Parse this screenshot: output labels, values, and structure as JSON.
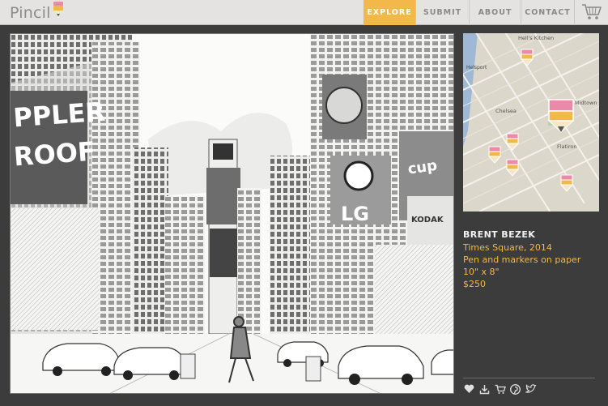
{
  "brand": {
    "name": "Pincil"
  },
  "nav": {
    "items": [
      {
        "label": "EXPLORE",
        "active": true
      },
      {
        "label": "SUBMIT",
        "active": false
      },
      {
        "label": "ABOUT",
        "active": false
      },
      {
        "label": "CONTACT",
        "active": false
      }
    ],
    "cart_icon": "cart-icon"
  },
  "artwork": {
    "subject": "Times Square street sketch",
    "signs": [
      "LG",
      "KODAK",
      "CUPCAKE",
      "PLER ROOF"
    ]
  },
  "map": {
    "labels": [
      "Hell's Kitchen",
      "Midtown",
      "Chelsea",
      "Flatiron",
      "Helsport"
    ],
    "pin_icon": "pencil-pin-icon"
  },
  "details": {
    "artist": "BRENT BEZEK",
    "title_year": "Times Square, 2014",
    "medium": "Pen and markers on paper",
    "size": "10\" x 8\"",
    "price": "$250"
  },
  "actions": [
    "heart-icon",
    "download-icon",
    "cart-icon",
    "pinterest-icon",
    "twitter-icon"
  ],
  "colors": {
    "accent": "#f2b84a",
    "pin_pink": "#e88aa8",
    "background": "#3c3c3c"
  }
}
